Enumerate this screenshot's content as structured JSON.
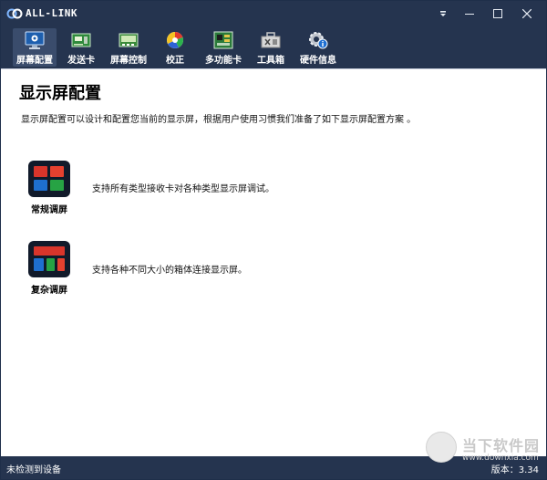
{
  "window": {
    "title": "ALL-LINK"
  },
  "toolbar": {
    "items": [
      {
        "label": "屏幕配置",
        "icon": "monitor-config-icon",
        "active": true
      },
      {
        "label": "发送卡",
        "icon": "sender-card-icon",
        "active": false
      },
      {
        "label": "屏幕控制",
        "icon": "screen-control-icon",
        "active": false
      },
      {
        "label": "校正",
        "icon": "calibration-icon",
        "active": false
      },
      {
        "label": "多功能卡",
        "icon": "multifunction-card-icon",
        "active": false
      },
      {
        "label": "工具箱",
        "icon": "toolbox-icon",
        "active": false
      },
      {
        "label": "硬件信息",
        "icon": "hardware-info-icon",
        "active": false
      }
    ]
  },
  "main": {
    "title": "显示屏配置",
    "description": "显示屏配置可以设计和配置您当前的显示屏，根据用户使用习惯我们准备了如下显示屏配置方案 。",
    "modes": [
      {
        "label": "常规调屏",
        "description": "支持所有类型接收卡对各种类型显示屏调试。",
        "icon": "regular-screen-icon"
      },
      {
        "label": "复杂调屏",
        "description": "支持各种不同大小的箱体连接显示屏。",
        "icon": "complex-screen-icon"
      }
    ]
  },
  "status": {
    "left": "未检测到设备",
    "version": "版本：3.34"
  },
  "watermark": {
    "text": "当下软件园",
    "sub": "www.downxia.com"
  },
  "colors": {
    "chrome": "#25344f",
    "active_tab": "#3a4c6c"
  }
}
